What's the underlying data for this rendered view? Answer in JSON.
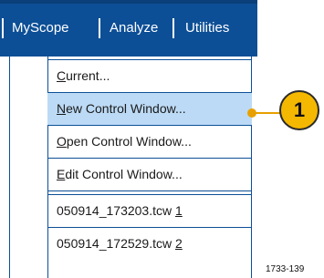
{
  "menubar": {
    "items": [
      {
        "label": "MyScope"
      },
      {
        "label": "Analyze"
      },
      {
        "label": "Utilities"
      }
    ]
  },
  "dropdown": {
    "items": [
      {
        "pre": "",
        "u": "C",
        "post": "urrent..."
      },
      {
        "pre": "",
        "u": "N",
        "post": "ew Control Window..."
      },
      {
        "pre": "",
        "u": "O",
        "post": "pen Control Window..."
      },
      {
        "pre": "",
        "u": "E",
        "post": "dit Control Window..."
      },
      {
        "pre": "050914_173203.tcw ",
        "u": "1",
        "post": ""
      },
      {
        "pre": "050914_172529.tcw ",
        "u": "2",
        "post": ""
      }
    ],
    "highlighted_index": 1
  },
  "callout": {
    "number": "1"
  },
  "figure_id": "1733-139",
  "colors": {
    "menubar": "#0d4f96",
    "highlight": "#bcdaf5",
    "callout": "#f5b800"
  }
}
